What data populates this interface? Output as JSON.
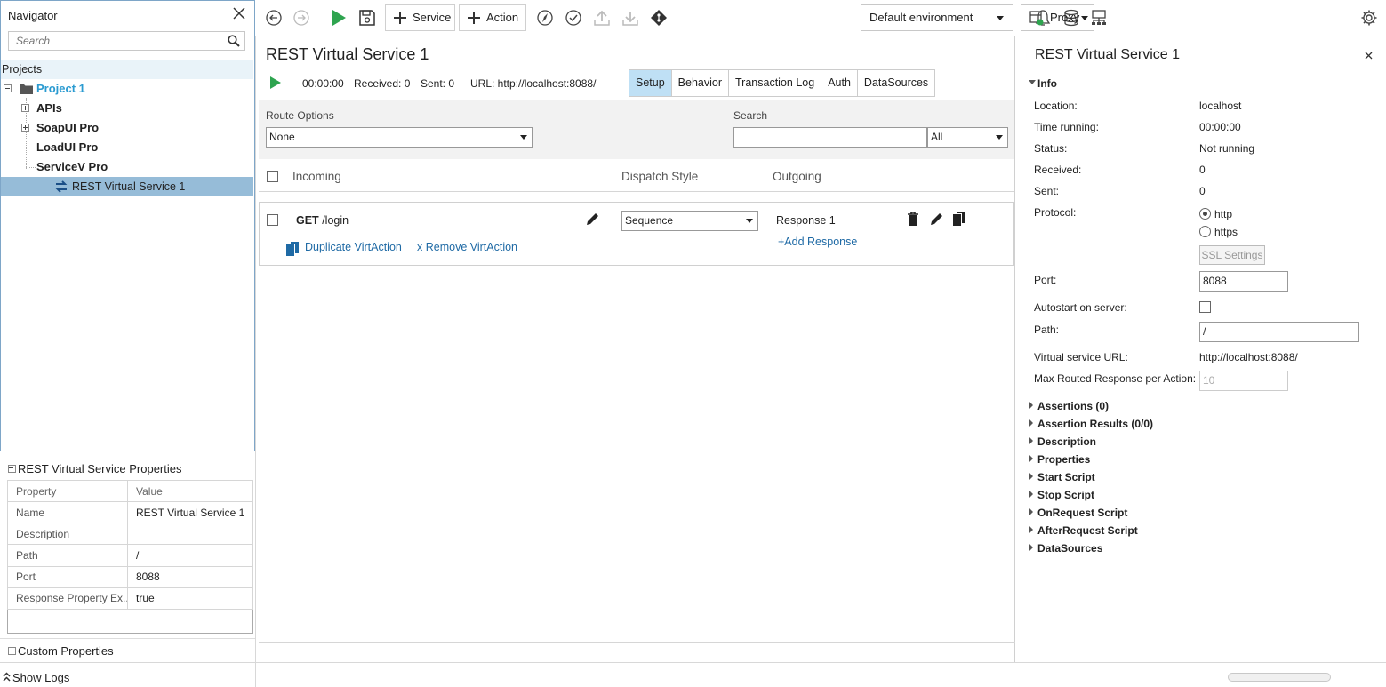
{
  "navigator": {
    "title": "Navigator",
    "search_placeholder": "Search",
    "projects_label": "Projects",
    "tree": {
      "project": "Project 1",
      "apis": "APIs",
      "soapui": "SoapUI Pro",
      "loadui": "LoadUI Pro",
      "servicev": "ServiceV Pro",
      "virtual_service": "REST Virtual Service 1"
    }
  },
  "properties_panel": {
    "title": "REST Virtual Service Properties",
    "col_property": "Property",
    "col_value": "Value",
    "rows": [
      {
        "k": "Name",
        "v": "REST Virtual Service 1"
      },
      {
        "k": "Description",
        "v": ""
      },
      {
        "k": "Path",
        "v": "/"
      },
      {
        "k": "Port",
        "v": "8088"
      },
      {
        "k": "Response Property Ex...",
        "v": "true"
      }
    ],
    "custom_properties": "Custom Properties",
    "show_logs": "Show Logs"
  },
  "toolbar": {
    "service_label": "Service",
    "action_label": "Action",
    "environment": "Default environment",
    "proxy": "Proxy"
  },
  "service": {
    "title": "REST Virtual Service 1",
    "time": "00:00:00",
    "received": "Received: 0",
    "sent": "Sent: 0",
    "url": "URL: http://localhost:8088/",
    "tabs": [
      "Setup",
      "Behavior",
      "Transaction Log",
      "Auth",
      "DataSources"
    ],
    "route_options_label": "Route Options",
    "route_options_value": "None",
    "search_label": "Search",
    "search_filter": "All",
    "col_incoming": "Incoming",
    "col_dispatch": "Dispatch Style",
    "col_outgoing": "Outgoing",
    "action": {
      "method": "GET",
      "path": "/login",
      "dispatch": "Sequence",
      "response": "Response 1",
      "add_response": "+Add Response",
      "duplicate": "Duplicate VirtAction",
      "remove": "x Remove VirtAction"
    }
  },
  "right_panel": {
    "title": "REST Virtual Service 1",
    "info_label": "Info",
    "location_label": "Location:",
    "location_value": "localhost",
    "time_label": "Time running:",
    "time_value": "00:00:00",
    "status_label": "Status:",
    "status_value": "Not running",
    "received_label": "Received:",
    "received_value": "0",
    "sent_label": "Sent:",
    "sent_value": "0",
    "protocol_label": "Protocol:",
    "http": "http",
    "https": "https",
    "ssl_settings": "SSL Settings",
    "port_label": "Port:",
    "port_value": "8088",
    "autostart_label": "Autostart on server:",
    "path_label": "Path:",
    "path_value": "/",
    "vs_url_label": "Virtual service URL:",
    "vs_url_value": "http://localhost:8088/",
    "max_routed_label": "Max Routed Response per Action:",
    "max_routed_value": "10",
    "sections": [
      "Assertions (0)",
      "Assertion Results (0/0)",
      "Description",
      "Properties",
      "Start Script",
      "Stop Script",
      "OnRequest Script",
      "AfterRequest Script",
      "DataSources"
    ]
  }
}
